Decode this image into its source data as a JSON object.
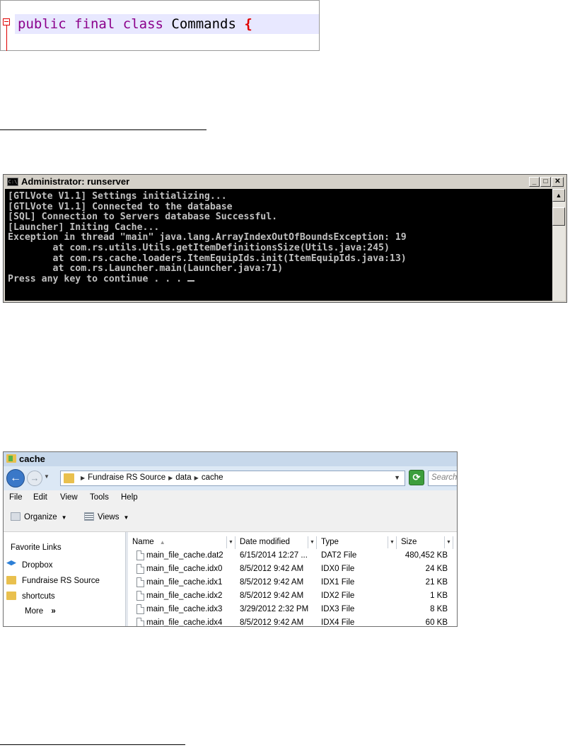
{
  "code": {
    "keyword1": "public",
    "keyword2": "final",
    "keyword3": "class",
    "class_name": "Commands",
    "brace": "{"
  },
  "console": {
    "title": "Administrator: runserver",
    "icon_label": "C:\\",
    "buttons": {
      "minimize": "_",
      "maximize": "□",
      "close": "✕"
    },
    "lines": [
      "[GTLVote V1.1] Settings initializing...",
      "[GTLVote V1.1] Connected to the database",
      "[SQL] Connection to Servers database Successful.",
      "[Launcher] Initing Cache...",
      "Exception in thread \"main\" java.lang.ArrayIndexOutOfBoundsException: 19",
      "        at com.rs.utils.Utils.getItemDefinitionsSize(Utils.java:245)",
      "        at com.rs.cache.loaders.ItemEquipIds.init(ItemEquipIds.java:13)",
      "        at com.rs.Launcher.main(Launcher.java:71)",
      "Press any key to continue . . . "
    ]
  },
  "explorer": {
    "title": "cache",
    "breadcrumbs": [
      "Fundraise RS Source",
      "data",
      "cache"
    ],
    "search_placeholder": "Search",
    "menu": [
      "File",
      "Edit",
      "View",
      "Tools",
      "Help"
    ],
    "toolbar": {
      "organize": "Organize",
      "views": "Views"
    },
    "favorites_header": "Favorite Links",
    "favorites": [
      {
        "label": "Dropbox",
        "icon": "dropbox-icon"
      },
      {
        "label": "Fundraise RS Source",
        "icon": "folder-icon"
      },
      {
        "label": "shortcuts",
        "icon": "folder-icon"
      }
    ],
    "more_label": "More",
    "more_glyph": "»",
    "columns": [
      "Name",
      "Date modified",
      "Type",
      "Size"
    ],
    "files": [
      {
        "name": "main_file_cache.dat2",
        "date": "6/15/2014 12:27 ...",
        "type": "DAT2 File",
        "size": "480,452 KB"
      },
      {
        "name": "main_file_cache.idx0",
        "date": "8/5/2012 9:42 AM",
        "type": "IDX0 File",
        "size": "24 KB"
      },
      {
        "name": "main_file_cache.idx1",
        "date": "8/5/2012 9:42 AM",
        "type": "IDX1 File",
        "size": "21 KB"
      },
      {
        "name": "main_file_cache.idx2",
        "date": "8/5/2012 9:42 AM",
        "type": "IDX2 File",
        "size": "1 KB"
      },
      {
        "name": "main_file_cache.idx3",
        "date": "3/29/2012 2:32 PM",
        "type": "IDX3 File",
        "size": "8 KB"
      },
      {
        "name": "main_file_cache.idx4",
        "date": "8/5/2012 9:42 AM",
        "type": "IDX4 File",
        "size": "60 KB"
      }
    ]
  }
}
